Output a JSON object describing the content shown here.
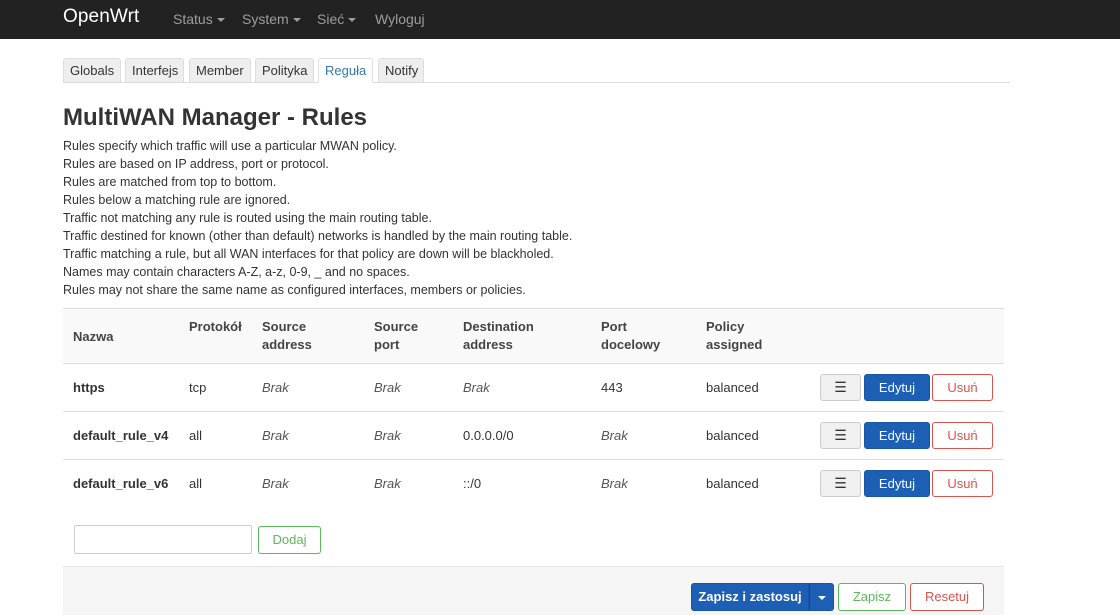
{
  "navbar": {
    "brand": "OpenWrt",
    "menu": [
      {
        "label": "Status",
        "dropdown": true
      },
      {
        "label": "System",
        "dropdown": true
      },
      {
        "label": "Sieć",
        "dropdown": true
      },
      {
        "label": "Wyloguj",
        "dropdown": false
      }
    ]
  },
  "tabs": [
    {
      "label": "Globals",
      "active": false
    },
    {
      "label": "Interfejs",
      "active": false
    },
    {
      "label": "Member",
      "active": false
    },
    {
      "label": "Polityka",
      "active": false
    },
    {
      "label": "Reguła",
      "active": true
    },
    {
      "label": "Notify",
      "active": false
    }
  ],
  "page": {
    "title": "MultiWAN Manager - Rules",
    "description": [
      "Rules specify which traffic will use a particular MWAN policy.",
      "Rules are based on IP address, port or protocol.",
      "Rules are matched from top to bottom.",
      "Rules below a matching rule are ignored.",
      "Traffic not matching any rule is routed using the main routing table.",
      "Traffic destined for known (other than default) networks is handled by the main routing table.",
      "Traffic matching a rule, but all WAN interfaces for that policy are down will be blackholed.",
      "Names may contain characters A-Z, a-z, 0-9, _ and no spaces.",
      "Rules may not share the same name as configured interfaces, members or policies."
    ]
  },
  "table": {
    "headers": {
      "name": "Nazwa",
      "protocol": "Protokół",
      "src_addr_1": "Source",
      "src_addr_2": "address",
      "src_port_1": "Source",
      "src_port_2": "port",
      "dest_addr_1": "Destination",
      "dest_addr_2": "address",
      "dest_port_1": "Port",
      "dest_port_2": "docelowy",
      "policy_1": "Policy",
      "policy_2": "assigned"
    },
    "rows": [
      {
        "name": "https",
        "protocol": "tcp",
        "src_addr": "Brak",
        "src_port": "Brak",
        "dest_addr": "Brak",
        "dest_port": "443",
        "policy": "balanced"
      },
      {
        "name": "default_rule_v4",
        "protocol": "all",
        "src_addr": "Brak",
        "src_port": "Brak",
        "dest_addr": "0.0.0.0/0",
        "dest_port": "Brak",
        "policy": "balanced"
      },
      {
        "name": "default_rule_v6",
        "protocol": "all",
        "src_addr": "Brak",
        "src_port": "Brak",
        "dest_addr": "::/0",
        "dest_port": "Brak",
        "policy": "balanced"
      }
    ],
    "actions": {
      "sort": "☰",
      "edit": "Edytuj",
      "delete": "Usuń"
    }
  },
  "add": {
    "input_value": "",
    "button": "Dodaj"
  },
  "footer": {
    "save_apply": "Zapisz i zastosuj",
    "save": "Zapisz",
    "reset": "Resetuj"
  },
  "colors": {
    "navbar_bg": "#222222",
    "primary": "#1c5fb5",
    "success": "#5cb85c",
    "danger": "#d9534f",
    "active_tab_text": "#337ab7"
  }
}
